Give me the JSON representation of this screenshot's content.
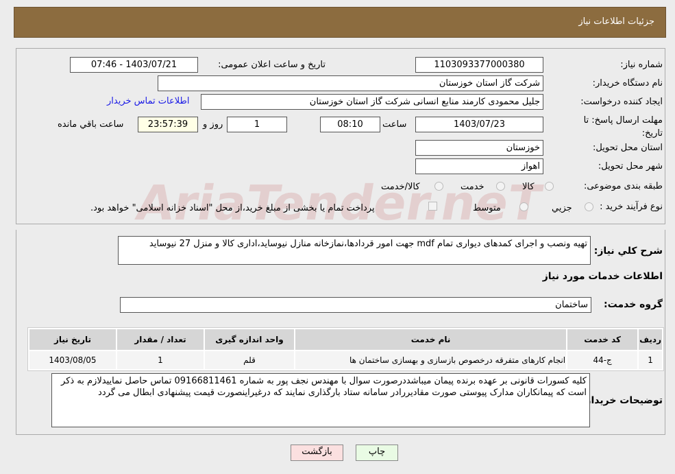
{
  "header": {
    "title": "جزئیات اطلاعات نیاز"
  },
  "form": {
    "need_number_label": "شماره نیاز:",
    "need_number": "1103093377000380",
    "announce_label": "تاریخ و ساعت اعلان عمومی:",
    "announce_value": "1403/07/21 - 07:46",
    "buyer_org_label": "نام دستگاه خریدار:",
    "buyer_org": "شرکت گاز استان خوزستان",
    "creator_label": "ایجاد کننده درخواست:",
    "creator": "جلیل محمودی کارمند منابع انسانی شرکت گاز استان خوزستان",
    "contact_link": "اطلاعات تماس خریدار",
    "deadline_label": "مهلت ارسال پاسخ: تا تاریخ:",
    "deadline_date": "1403/07/23",
    "time_label": "ساعت",
    "deadline_time": "08:10",
    "days": "1",
    "days_label": "روز و",
    "remaining": "23:57:39",
    "remaining_label": "ساعت باقي مانده",
    "province_label": "استان محل تحویل:",
    "province": "خوزستان",
    "city_label": "شهر محل تحویل:",
    "city": "اهواز",
    "category_label": "طبقه بندی موضوعی:",
    "category_options": [
      "کالا",
      "خدمت",
      "کالا/خدمت"
    ],
    "process_label": "نوع فرآیند خرید :",
    "process_options": [
      "جزيي",
      "متوسط"
    ],
    "process_note": "پرداخت تمام یا بخشی از مبلغ خرید،از محل \"اسناد خزانه اسلامی\" خواهد بود."
  },
  "watermark": "AriaTender.neT",
  "details": {
    "summary_label": "شرح كلي نياز:",
    "summary": "تهیه ونصب و اجرای کمدهای دیواری تمام mdf جهت امور قردادها،نمازخانه منازل نیوساید،اداری کالا و منزل 27 نیوساید",
    "services_title": "اطلاعات خدمات مورد نیاز",
    "group_label": "گروه خدمت:",
    "group": "ساختمان",
    "table": {
      "headers": [
        "ردیف",
        "کد خدمت",
        "نام خدمت",
        "واحد اندازه گیری",
        "تعداد / مقدار",
        "تاریخ نیاز"
      ],
      "rows": [
        [
          "1",
          "ج-44",
          "انجام کارهای متفرقه درخصوص بازسازی و بهسازی ساختمان ها",
          "قلم",
          "1",
          "1403/08/05"
        ]
      ]
    },
    "notes_label": "توضیحات خریدار:",
    "notes": "کلیه کسورات قانونی بر عهده برنده پیمان میباشددرصورت سوال با مهندس نجف پور به شماره 09166811461 تماس حاصل نماییدلازم به ذکر است که پیمانکاران مدارک پیوستی صورت مقادیررادر سامانه ستاد بارگذاری نمایند که درغیراینصورت قیمت پیشنهادی ابطال می گردد"
  },
  "buttons": {
    "print": "چاپ",
    "back": "بازگشت"
  }
}
